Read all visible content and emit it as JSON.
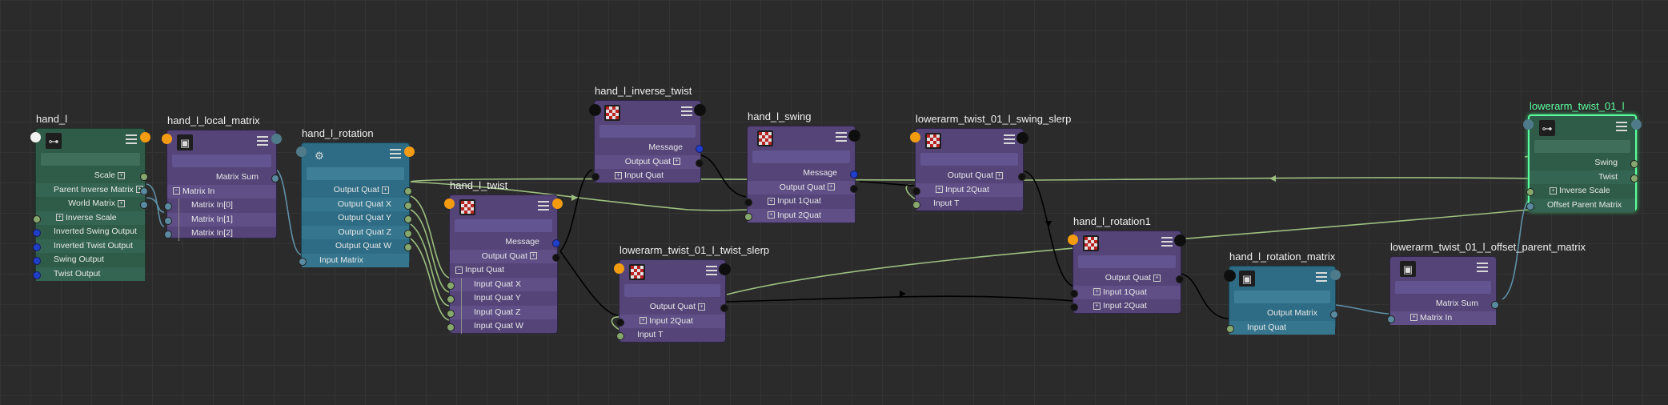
{
  "colors": {
    "background": "#2b2b2b",
    "wire_default": "#000000",
    "wire_highlight": "#9cbf7f",
    "wire_matrix": "#5f90a8",
    "selected_outline": "#5aff9e"
  },
  "nodes": {
    "hand_l": {
      "title": "hand_l",
      "icon": "joint-icon",
      "rows": [
        "Scale",
        "Parent Inverse Matrix",
        "World Matrix",
        "Inverse Scale",
        "Inverted Swing Output",
        "Inverted Twist Output",
        "Swing Output",
        "Twist Output"
      ]
    },
    "hand_l_local_matrix": {
      "title": "hand_l_local_matrix",
      "icon": "cube-icon",
      "rows": [
        "Matrix Sum",
        "Matrix In",
        "Matrix In[0]",
        "Matrix In[1]",
        "Matrix In[2]"
      ]
    },
    "hand_l_rotation": {
      "title": "hand_l_rotation",
      "icon": "decompose-icon",
      "rows": [
        "Output Quat",
        "Output Quat X",
        "Output Quat Y",
        "Output Quat Z",
        "Output Quat W",
        "Input Matrix"
      ]
    },
    "hand_l_twist": {
      "title": "hand_l_twist",
      "icon": "checker-icon",
      "rows": [
        "Message",
        "Output Quat",
        "Input Quat",
        "Input Quat X",
        "Input Quat Y",
        "Input Quat Z",
        "Input Quat W"
      ]
    },
    "hand_l_inverse_twist": {
      "title": "hand_l_inverse_twist",
      "icon": "checker-icon",
      "rows": [
        "Message",
        "Output Quat",
        "Input Quat"
      ]
    },
    "lowerarm_twist_01_l_twist_slerp": {
      "title": "lowerarm_twist_01_l_twist_slerp",
      "icon": "checker-icon",
      "rows": [
        "Output Quat",
        "Input 2Quat",
        "Input T"
      ]
    },
    "hand_l_swing": {
      "title": "hand_l_swing",
      "icon": "checker-icon",
      "rows": [
        "Message",
        "Output Quat",
        "Input 1Quat",
        "Input 2Quat"
      ]
    },
    "lowerarm_twist_01_l_swing_slerp": {
      "title": "lowerarm_twist_01_l_swing_slerp",
      "icon": "checker-icon",
      "rows": [
        "Output Quat",
        "Input 2Quat",
        "Input T"
      ]
    },
    "hand_l_rotation1": {
      "title": "hand_l_rotation1",
      "icon": "checker-icon",
      "rows": [
        "Output Quat",
        "Input 1Quat",
        "Input 2Quat"
      ]
    },
    "hand_l_rotation_matrix": {
      "title": "hand_l_rotation_matrix",
      "icon": "cube-icon",
      "rows": [
        "Output Matrix",
        "Input Quat"
      ]
    },
    "lowerarm_twist_01_l_offset_parent_matrix": {
      "title": "lowerarm_twist_01_l_offset_parent_matrix",
      "icon": "cube-icon",
      "rows": [
        "Matrix Sum",
        "Matrix In"
      ]
    },
    "lowerarm_twist_01_l": {
      "title": "lowerarm_twist_01_l",
      "icon": "joint-icon",
      "rows": [
        "Swing",
        "Twist",
        "Inverse Scale",
        "Offset Parent Matrix"
      ]
    }
  }
}
